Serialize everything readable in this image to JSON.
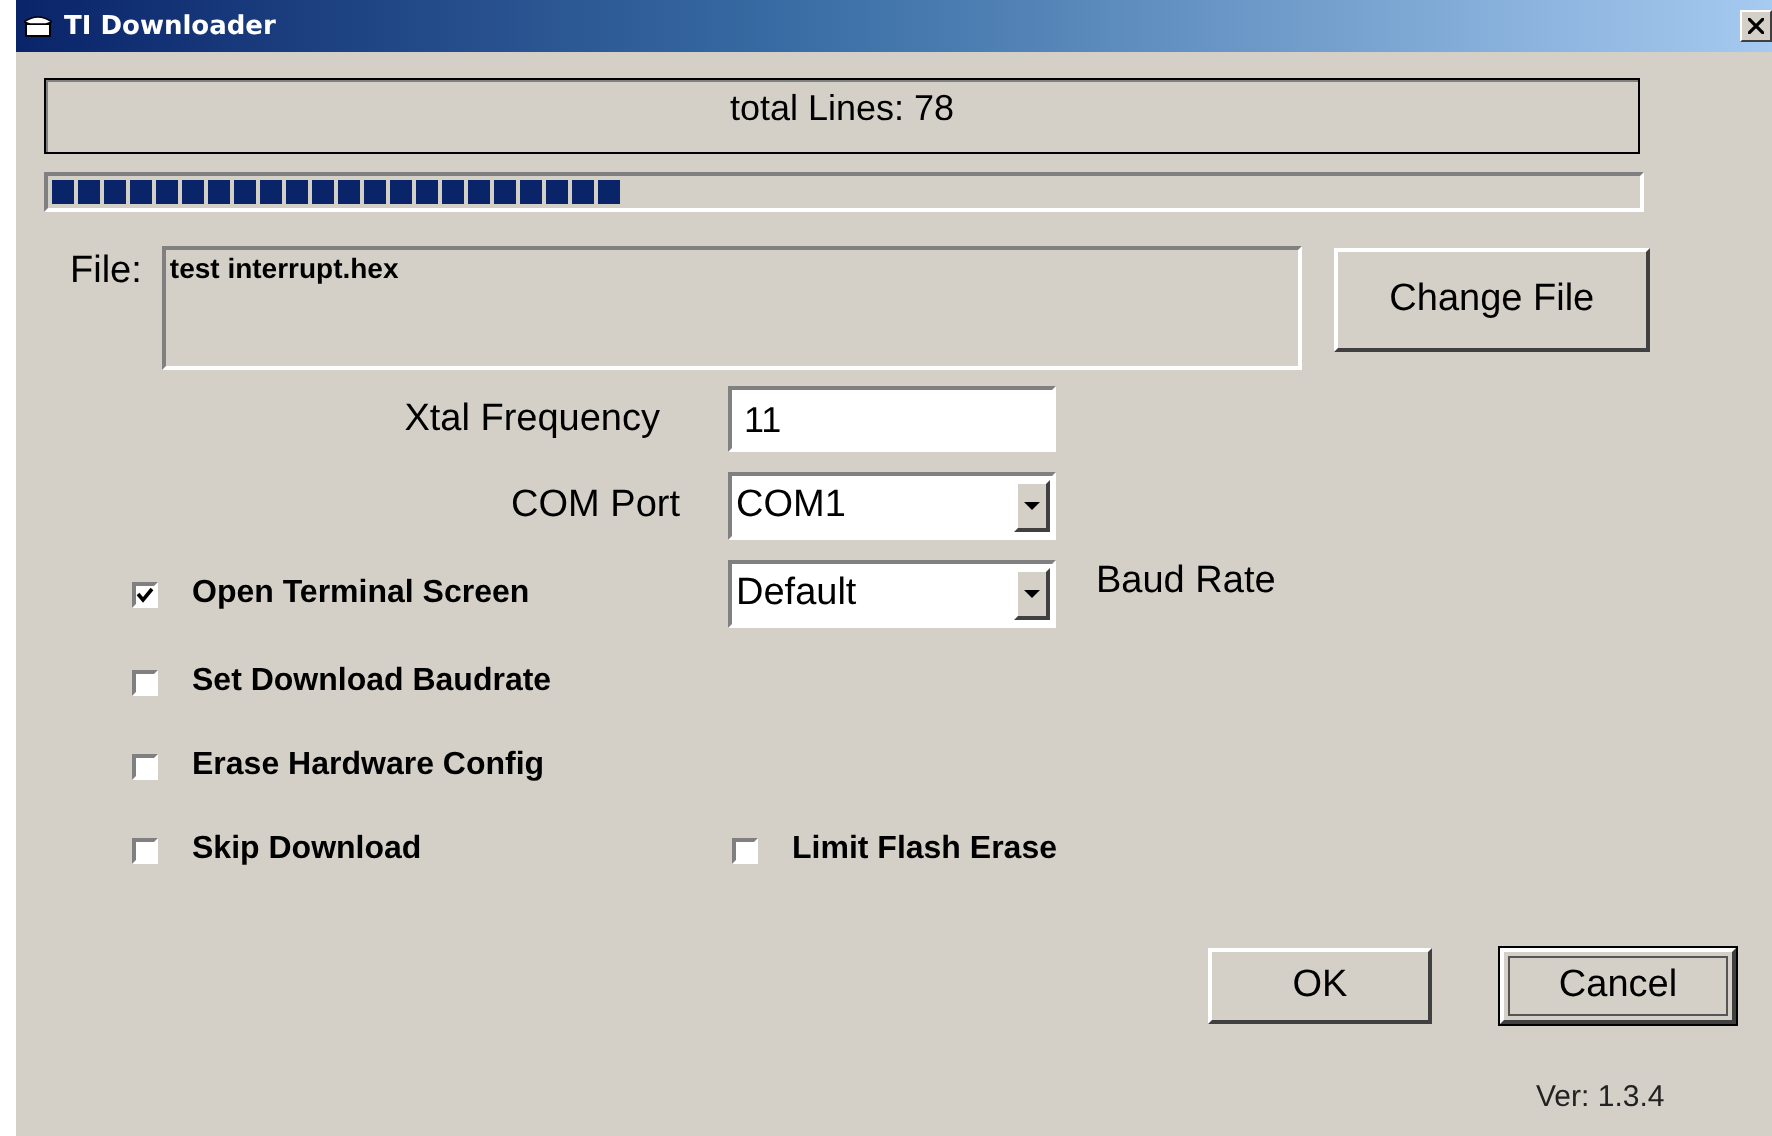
{
  "window": {
    "title": "TI Downloader"
  },
  "status": {
    "text": "total Lines: 78"
  },
  "progress": {
    "level": 0.36
  },
  "file": {
    "label": "File:",
    "value": "test interrupt.hex",
    "button": "Change File"
  },
  "xtal": {
    "label": "Xtal Frequency",
    "value": "11"
  },
  "com_port": {
    "label": "COM Port",
    "value": "COM1"
  },
  "terminal": {
    "label": "Open Terminal Screen",
    "checked": true,
    "baud_value": "Default",
    "baud_label": "Baud Rate"
  },
  "option_rows": [
    {
      "items": [
        {
          "label": "Set Download Baudrate",
          "checked": false
        }
      ]
    },
    {
      "items": [
        {
          "label": "Erase Hardware Config",
          "checked": false
        }
      ]
    },
    {
      "items": [
        {
          "label": "Skip Download",
          "checked": false
        },
        {
          "label": "Limit Flash Erase",
          "checked": false
        }
      ]
    }
  ],
  "buttons": [
    {
      "label": "OK",
      "focused": false
    },
    {
      "label": "Cancel",
      "focused": true
    }
  ],
  "version": "Ver: 1.3.4"
}
